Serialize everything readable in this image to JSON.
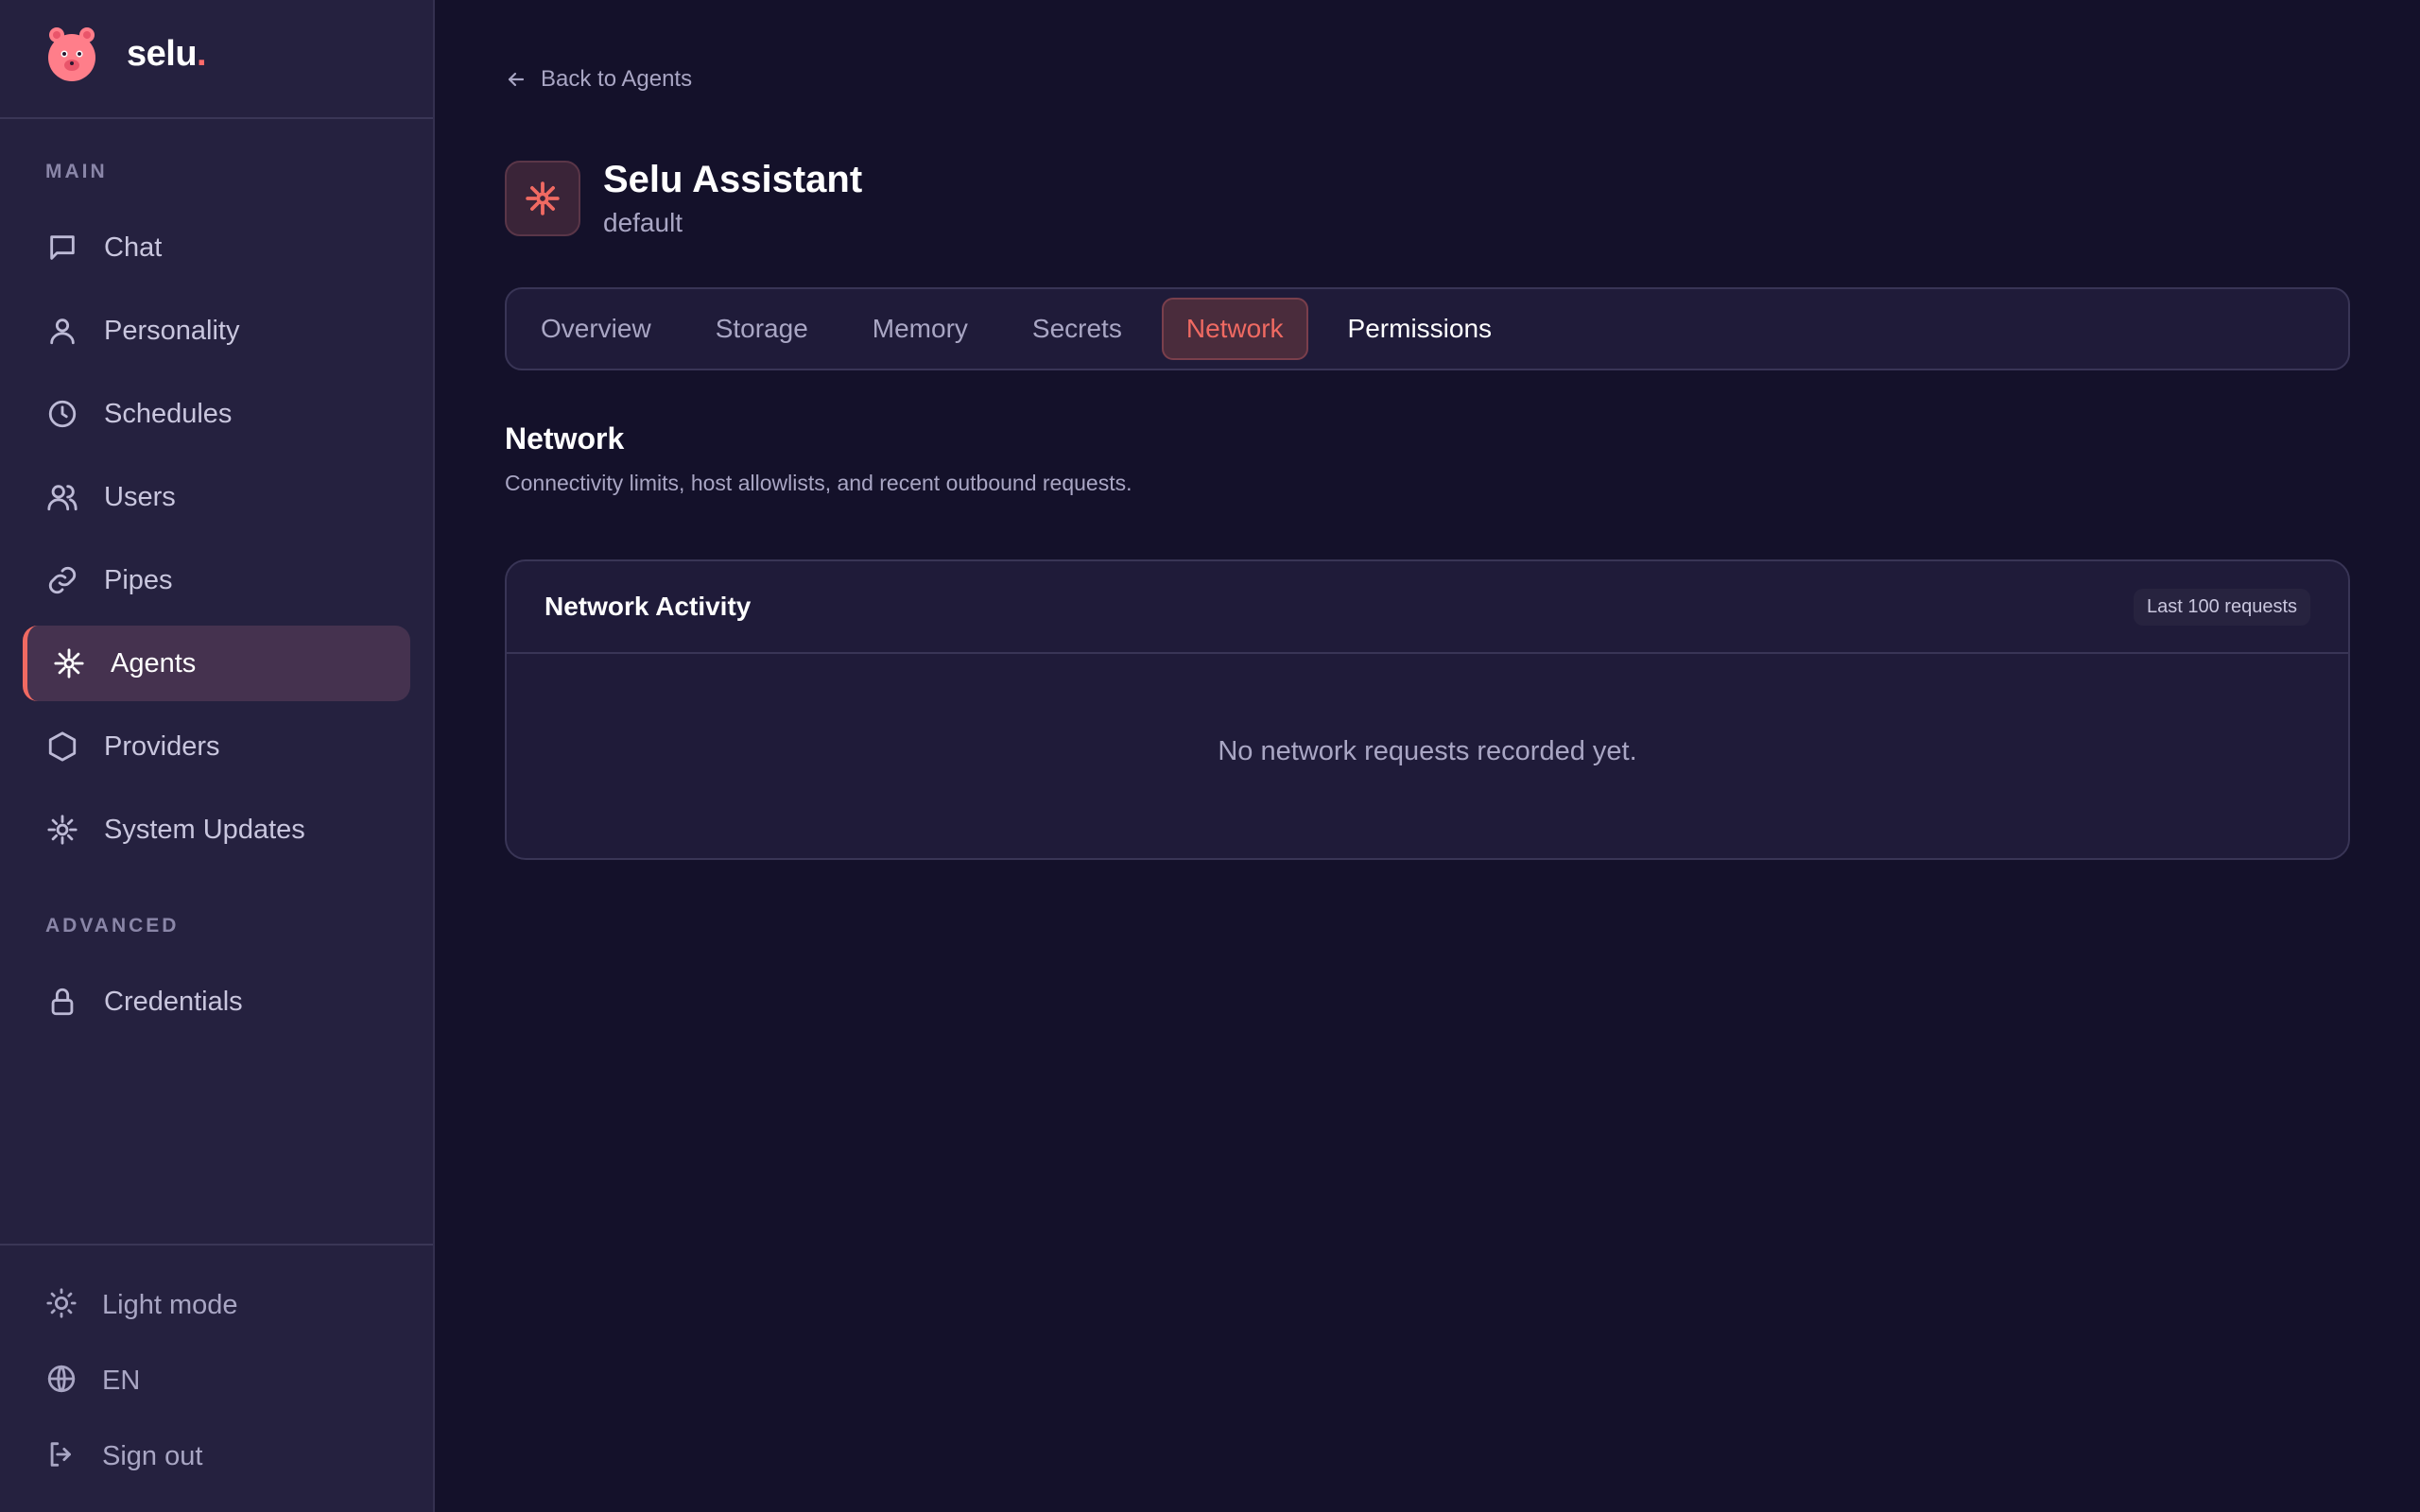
{
  "brand": {
    "name": "selu",
    "dot": "."
  },
  "sidebar": {
    "section_main": "MAIN",
    "section_advanced": "ADVANCED",
    "items": [
      {
        "id": "chat",
        "label": "Chat",
        "icon": "chat-bubble-icon"
      },
      {
        "id": "personality",
        "label": "Personality",
        "icon": "user-icon"
      },
      {
        "id": "schedules",
        "label": "Schedules",
        "icon": "clock-icon"
      },
      {
        "id": "users",
        "label": "Users",
        "icon": "users-icon"
      },
      {
        "id": "pipes",
        "label": "Pipes",
        "icon": "link-icon"
      },
      {
        "id": "agents",
        "label": "Agents",
        "icon": "agent-icon",
        "active": true
      },
      {
        "id": "providers",
        "label": "Providers",
        "icon": "hexagon-icon"
      },
      {
        "id": "system-updates",
        "label": "System Updates",
        "icon": "sparkle-icon"
      }
    ],
    "advanced_items": [
      {
        "id": "credentials",
        "label": "Credentials",
        "icon": "lock-icon"
      }
    ],
    "bottom": {
      "theme": "Light mode",
      "language": "EN",
      "signout": "Sign out"
    }
  },
  "main": {
    "back_label": "Back to Agents",
    "agent": {
      "name": "Selu Assistant",
      "id": "default"
    },
    "tabs": [
      "Overview",
      "Storage",
      "Memory",
      "Secrets",
      "Network",
      "Permissions"
    ],
    "active_tab": "Network",
    "section": {
      "title": "Network",
      "description": "Connectivity limits, host allowlists, and recent outbound requests."
    },
    "activity": {
      "title": "Network Activity",
      "badge": "Last 100 requests",
      "empty": "No network requests recorded yet."
    }
  },
  "colors": {
    "accent": "#f06a62",
    "background": "#14112a",
    "sidebar": "#25213f",
    "card": "#1f1b39"
  }
}
